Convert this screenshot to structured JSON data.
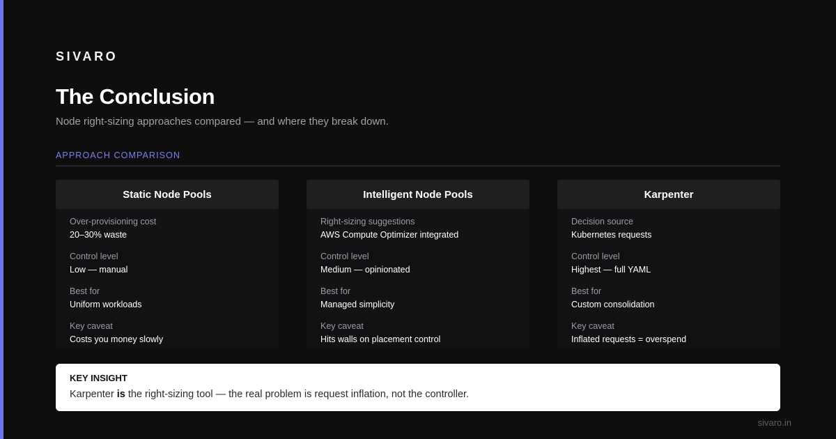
{
  "brand": "SIVARO",
  "title": "The Conclusion",
  "subtitle": "Node right-sizing approaches compared — and where they break down.",
  "section_label": "APPROACH COMPARISON",
  "columns": [
    {
      "header": "Static Node Pools",
      "rows": [
        {
          "label": "Over-provisioning cost",
          "value": "20–30% waste"
        },
        {
          "label": "Control level",
          "value": "Low — manual"
        },
        {
          "label": "Best for",
          "value": "Uniform workloads"
        },
        {
          "label": "Key caveat",
          "value": "Costs you money slowly"
        }
      ]
    },
    {
      "header": "Intelligent Node Pools",
      "rows": [
        {
          "label": "Right-sizing suggestions",
          "value": "AWS Compute Optimizer integrated"
        },
        {
          "label": "Control level",
          "value": "Medium — opinionated"
        },
        {
          "label": "Best for",
          "value": "Managed simplicity"
        },
        {
          "label": "Key caveat",
          "value": "Hits walls on placement control"
        }
      ]
    },
    {
      "header": "Karpenter",
      "rows": [
        {
          "label": "Decision source",
          "value": "Kubernetes requests"
        },
        {
          "label": "Control level",
          "value": "Highest — full YAML"
        },
        {
          "label": "Best for",
          "value": "Custom consolidation"
        },
        {
          "label": "Key caveat",
          "value": "Inflated requests = overspend"
        }
      ]
    }
  ],
  "insight": {
    "title": "KEY INSIGHT",
    "text_before": "Karpenter ",
    "text_bold": "is",
    "text_after": " the right-sizing tool — the real problem is request inflation, not the controller."
  },
  "footer_url": "sivaro.in",
  "colors": {
    "background": "#0e0e0f",
    "accent": "#6f74f0",
    "card_header": "#1f1f22",
    "insight_bg": "#ffffff"
  }
}
